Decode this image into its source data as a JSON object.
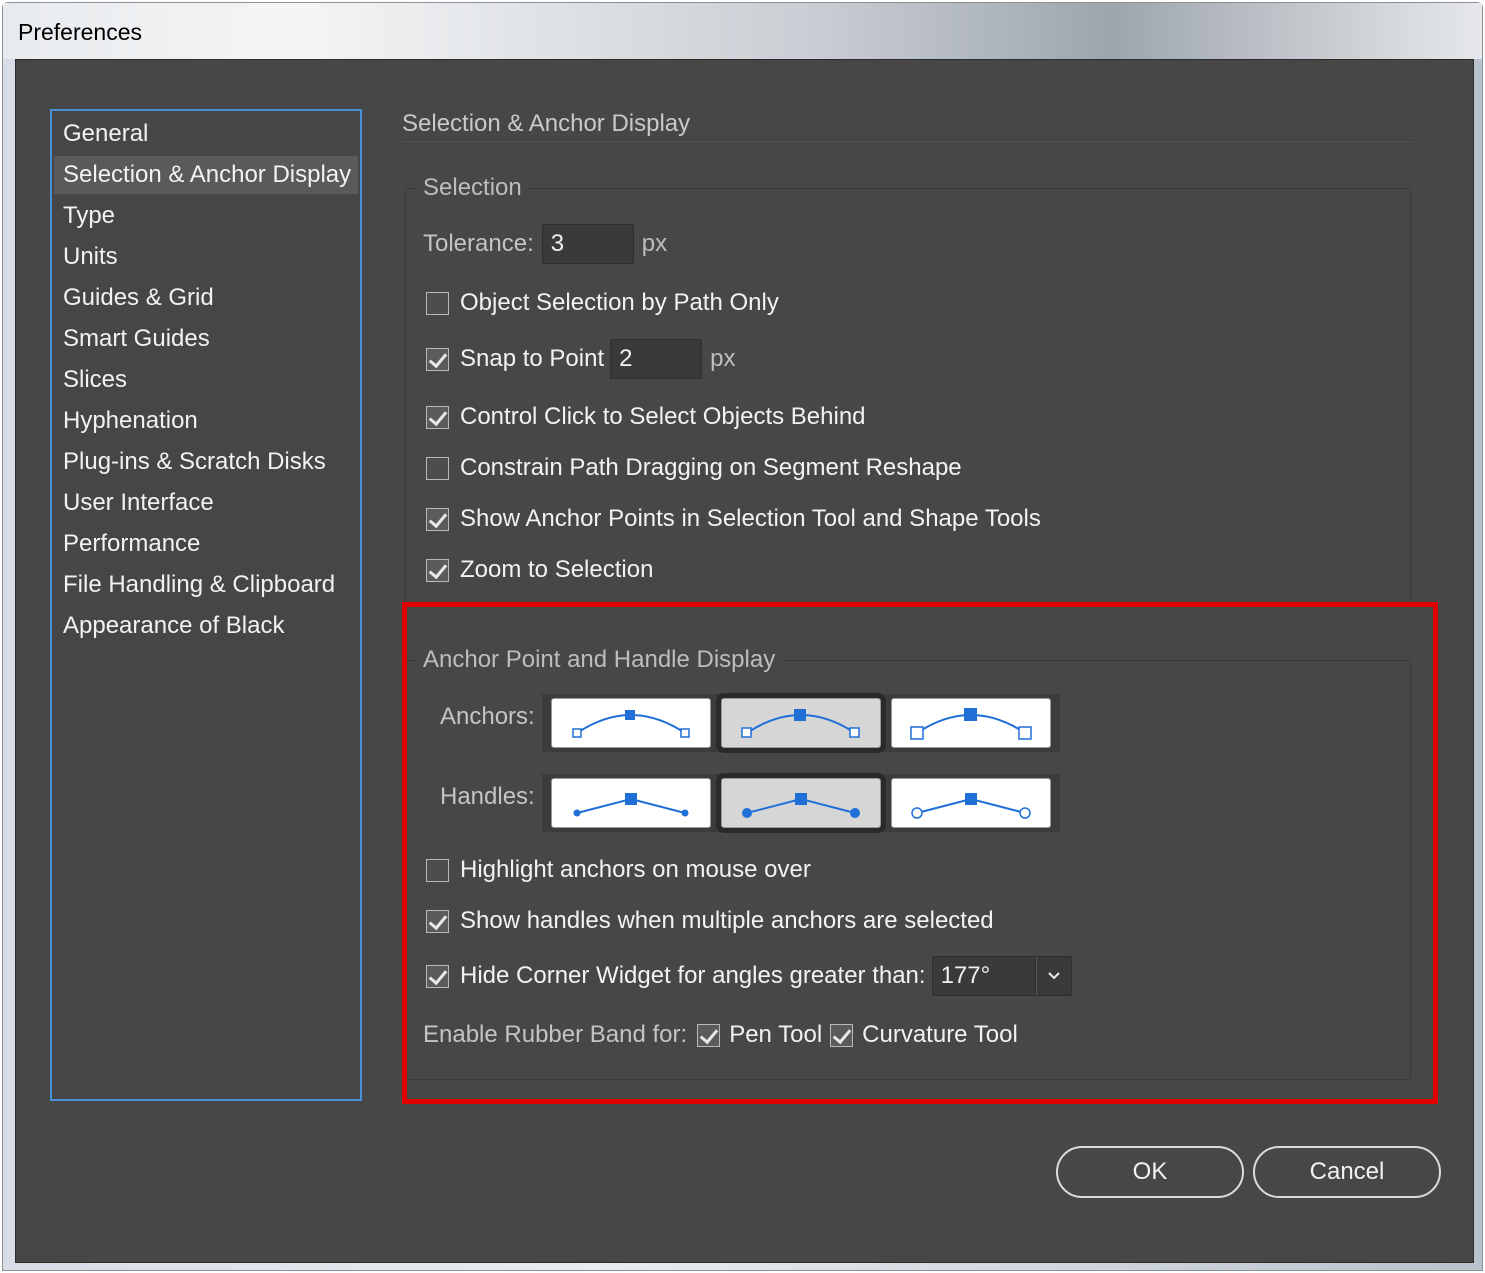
{
  "window": {
    "title": "Preferences"
  },
  "sidebar": {
    "items": [
      {
        "label": "General"
      },
      {
        "label": "Selection & Anchor Display"
      },
      {
        "label": "Type"
      },
      {
        "label": "Units"
      },
      {
        "label": "Guides & Grid"
      },
      {
        "label": "Smart Guides"
      },
      {
        "label": "Slices"
      },
      {
        "label": "Hyphenation"
      },
      {
        "label": "Plug-ins & Scratch Disks"
      },
      {
        "label": "User Interface"
      },
      {
        "label": "Performance"
      },
      {
        "label": "File Handling & Clipboard"
      },
      {
        "label": "Appearance of Black"
      }
    ],
    "selected_index": 1
  },
  "page": {
    "title": "Selection & Anchor Display"
  },
  "selection": {
    "group_title": "Selection",
    "tolerance_label": "Tolerance:",
    "tolerance_value": "3",
    "tolerance_unit": "px",
    "object_selection_by_path_label": "Object Selection by Path Only",
    "object_selection_by_path_checked": false,
    "snap_to_point_label": "Snap to Point",
    "snap_to_point_checked": true,
    "snap_to_point_value": "2",
    "snap_to_point_unit": "px",
    "control_click_label": "Control Click to Select Objects Behind",
    "control_click_checked": true,
    "constrain_path_label": "Constrain Path Dragging on Segment Reshape",
    "constrain_path_checked": false,
    "show_anchor_points_label": "Show Anchor Points in Selection Tool and Shape Tools",
    "show_anchor_points_checked": true,
    "zoom_to_selection_label": "Zoom to Selection",
    "zoom_to_selection_checked": true
  },
  "anchor_display": {
    "group_title": "Anchor Point and Handle Display",
    "anchors_label": "Anchors:",
    "anchors_selected_index": 1,
    "handles_label": "Handles:",
    "handles_selected_index": 1,
    "highlight_anchors_label": "Highlight anchors on mouse over",
    "highlight_anchors_checked": false,
    "show_handles_label": "Show handles when multiple anchors are selected",
    "show_handles_checked": true,
    "hide_corner_widget_label": "Hide Corner Widget for angles greater than:",
    "hide_corner_widget_checked": true,
    "hide_corner_widget_value": "177°",
    "rubber_band_label": "Enable Rubber Band for:",
    "pen_tool_label": "Pen Tool",
    "pen_tool_checked": true,
    "curvature_tool_label": "Curvature Tool",
    "curvature_tool_checked": true
  },
  "buttons": {
    "ok_label": "OK",
    "cancel_label": "Cancel"
  },
  "colors": {
    "dialog_bg": "#474747",
    "list_border": "#4b8fd6",
    "highlight_box": "#e10000",
    "anchor_blue": "#1f6fd6"
  }
}
